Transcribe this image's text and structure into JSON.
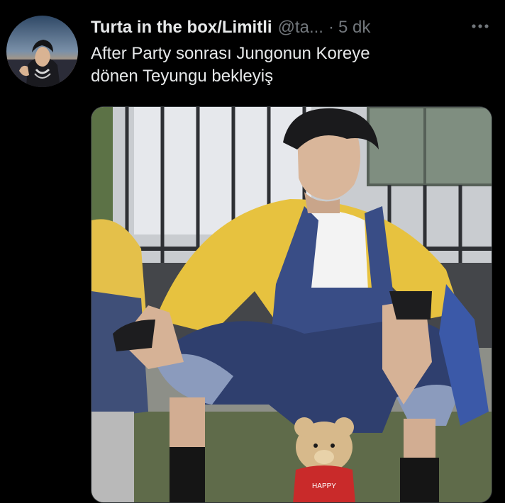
{
  "tweet": {
    "display_name": "Turta in the box/Limitli",
    "handle": "@ta...",
    "separator": "·",
    "time": "5 dk",
    "text_line1": "After Party sonrası Jungonun Koreye",
    "text_line2": "dönen Teyungu bekleyiş"
  },
  "media": {
    "bear_shirt_text": "HAPPY"
  },
  "icons": {
    "avatar": "profile-avatar",
    "more": "more-horizontal-icon"
  },
  "colors": {
    "background": "#000000",
    "primary_text": "#e7e9ea",
    "secondary_text": "#71767b",
    "border": "#2f3336"
  }
}
